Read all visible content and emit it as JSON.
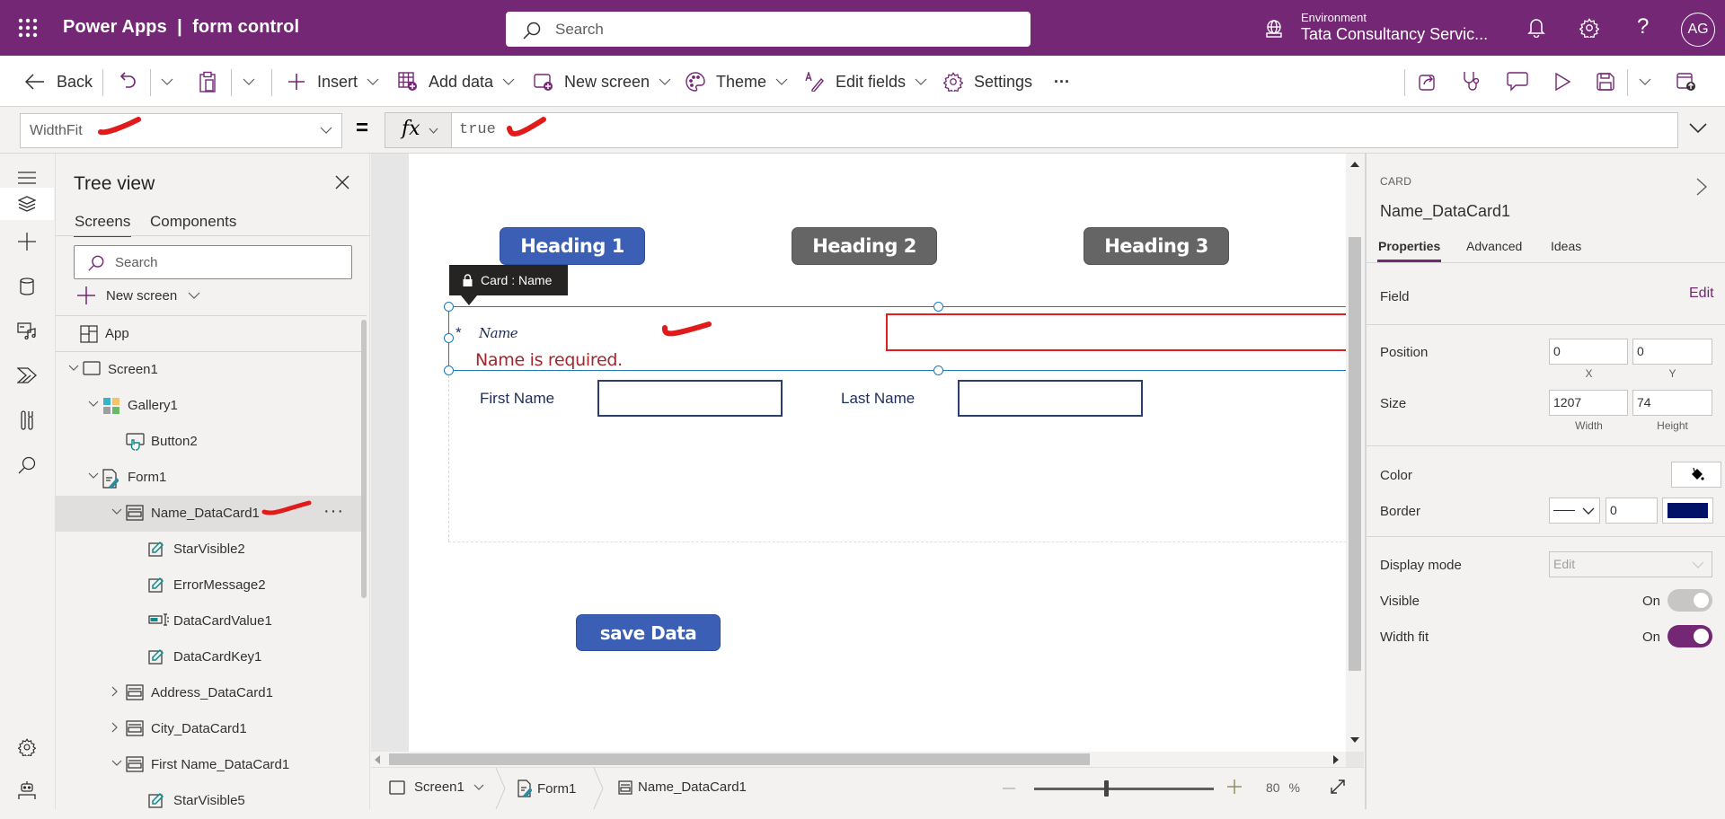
{
  "topbar": {
    "app_title": "Power Apps  |  form control",
    "search_placeholder": "Search",
    "environment_label": "Environment",
    "environment_name": "Tata Consultancy Servic...",
    "avatar_initials": "AG"
  },
  "toolbar": {
    "back": "Back",
    "insert": "Insert",
    "add_data": "Add data",
    "new_screen": "New screen",
    "theme": "Theme",
    "edit_fields": "Edit fields",
    "settings": "Settings",
    "more": "···"
  },
  "formula_bar": {
    "property": "WidthFit",
    "equals": "=",
    "fx": "fx",
    "formula": "true"
  },
  "tree_view": {
    "title": "Tree view",
    "tabs": [
      {
        "label": "Screens",
        "active": true
      },
      {
        "label": "Components",
        "active": false
      }
    ],
    "search_placeholder": "Search",
    "new_screen": "New screen",
    "items": [
      {
        "label": "App",
        "icon": "app-icon",
        "level": 0,
        "expander": "none"
      },
      {
        "label": "Screen1",
        "icon": "screen-icon",
        "level": 0,
        "expander": "expanded"
      },
      {
        "label": "Gallery1",
        "icon": "gallery-icon",
        "level": 1,
        "expander": "expanded"
      },
      {
        "label": "Button2",
        "icon": "button-icon",
        "level": 2,
        "expander": "none"
      },
      {
        "label": "Form1",
        "icon": "form-icon",
        "level": 1,
        "expander": "expanded"
      },
      {
        "label": "Name_DataCard1",
        "icon": "card-icon",
        "level": 2,
        "expander": "expanded",
        "selected": true
      },
      {
        "label": "StarVisible2",
        "icon": "label-icon",
        "level": 3,
        "expander": "none"
      },
      {
        "label": "ErrorMessage2",
        "icon": "label-icon",
        "level": 3,
        "expander": "none"
      },
      {
        "label": "DataCardValue1",
        "icon": "text-input-icon",
        "level": 3,
        "expander": "none"
      },
      {
        "label": "DataCardKey1",
        "icon": "label-icon",
        "level": 3,
        "expander": "none"
      },
      {
        "label": "Address_DataCard1",
        "icon": "card-icon",
        "level": 2,
        "expander": "collapsed"
      },
      {
        "label": "City_DataCard1",
        "icon": "card-icon",
        "level": 2,
        "expander": "collapsed"
      },
      {
        "label": "First Name_DataCard1",
        "icon": "card-icon",
        "level": 2,
        "expander": "expanded"
      },
      {
        "label": "StarVisible5",
        "icon": "label-icon",
        "level": 3,
        "expander": "none"
      }
    ],
    "more_options": "···"
  },
  "canvas": {
    "headings": [
      "Heading 1",
      "Heading 2",
      "Heading 3"
    ],
    "card_tag": "Card : Name",
    "required_star": "*",
    "name_label": "Name",
    "error_message": "Name is required.",
    "first_name_label": "First Name",
    "last_name_label": "Last Name",
    "save_button": "save Data"
  },
  "bottombar": {
    "breadcrumb": [
      "Screen1",
      "Form1",
      "Name_DataCard1"
    ],
    "zoom_value": "80",
    "zoom_unit": "%",
    "zoom_level_fraction": 0.4
  },
  "properties": {
    "control_type": "CARD",
    "control_name": "Name_DataCard1",
    "tabs": [
      {
        "label": "Properties",
        "active": true
      },
      {
        "label": "Advanced",
        "active": false
      },
      {
        "label": "Ideas",
        "active": false
      }
    ],
    "field_label": "Field",
    "field_edit": "Edit",
    "position_label": "Position",
    "position_x": "0",
    "position_y": "0",
    "x_label": "X",
    "y_label": "Y",
    "size_label": "Size",
    "width": "1207",
    "height": "74",
    "width_label": "Width",
    "height_label": "Height",
    "color_label": "Color",
    "border_label": "Border",
    "border_width": "0",
    "border_color": "#001166",
    "display_mode_label": "Display mode",
    "display_mode_value": "Edit",
    "visible_label": "Visible",
    "visible_state": "On",
    "width_fit_label": "Width fit",
    "width_fit_state": "On"
  },
  "colors": {
    "brand": "#742774",
    "heading_active": "#3a5fb4",
    "heading_inactive": "#656565",
    "error": "#a4262c",
    "selection": "#1f7bb5"
  }
}
